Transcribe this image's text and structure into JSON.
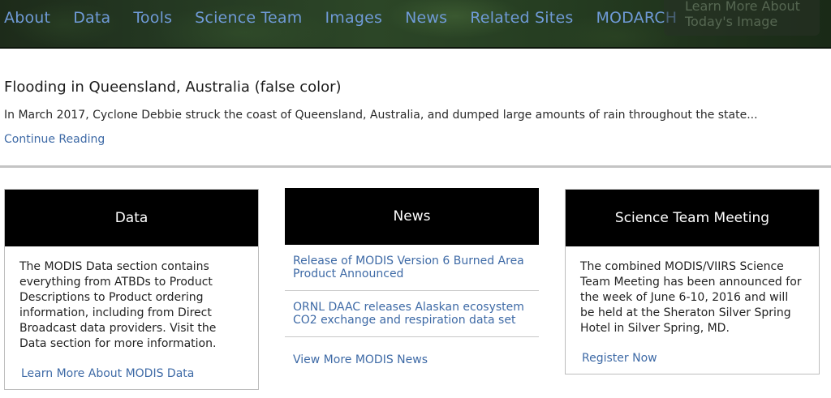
{
  "nav": {
    "items": [
      "About",
      "Data",
      "Tools",
      "Science Team",
      "Images",
      "News",
      "Related Sites",
      "MODARCH"
    ],
    "learn_more": "Learn More About Today's Image"
  },
  "feature": {
    "title": "Flooding in Queensland, Australia (false color)",
    "description": "In March 2017, Cyclone Debbie struck the coast of Queensland, Australia, and dumped large amounts of rain throughout the state...",
    "link": "Continue Reading"
  },
  "cards": {
    "data": {
      "title": "Data",
      "body": "The MODIS Data section contains everything from ATBDs to Product Descriptions to Product ordering information, including from Direct Broadcast data providers. Visit the Data section for more information.",
      "link": "Learn More About MODIS Data"
    },
    "news": {
      "title": "News",
      "items": [
        "Release of MODIS Version 6 Burned Area Product Announced",
        "ORNL DAAC releases Alaskan ecosystem CO2 exchange and respiration data set"
      ],
      "link": "View More MODIS News"
    },
    "science_team": {
      "title": "Science Team Meeting",
      "body": "The combined MODIS/VIIRS Science Team Meeting has been announced for the week of June 6-10, 2016 and will be held at the Sheraton Silver Spring Hotel in Silver Spring, MD.",
      "link": "Register Now"
    }
  },
  "colors": {
    "link": "#3e6aa6",
    "nav_link": "#6f9ad6",
    "card_header": "#000000"
  }
}
